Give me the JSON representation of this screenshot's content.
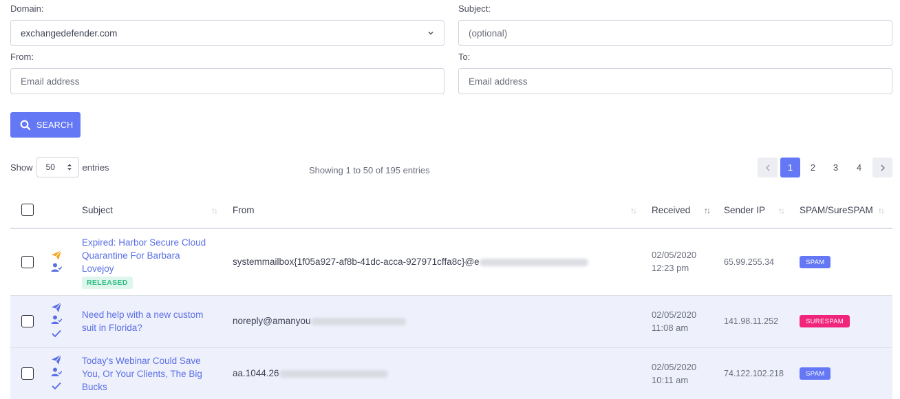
{
  "filters": {
    "domain_label": "Domain:",
    "domain_value": "exchangedefender.com",
    "subject_label": "Subject:",
    "subject_placeholder": "(optional)",
    "from_label": "From:",
    "from_placeholder": "Email address",
    "to_label": "To:",
    "to_placeholder": "Email address",
    "search_label": "SEARCH"
  },
  "table_controls": {
    "show_label": "Show",
    "page_length": "50",
    "entries_label": "entries",
    "info": "Showing 1 to 50 of 195 entries",
    "pages": [
      "1",
      "2",
      "3",
      "4"
    ],
    "current_page": "1"
  },
  "columns": [
    "Subject",
    "From",
    "Received",
    "Sender IP",
    "SPAM/SureSPAM"
  ],
  "rows": [
    {
      "subject_lines": [
        "Expired: Harbor Secure Cloud",
        "Quarantine For Barbara",
        "Lovejoy"
      ],
      "status": "RELEASED",
      "from": "systemmailbox{1f05a927-af8b-41dc-acca-927971cffa8c}@e",
      "received_date": "02/05/2020",
      "received_time": "12:23 pm",
      "sender_ip": "65.99.255.34",
      "classification": "SPAM"
    },
    {
      "subject_lines": [
        "Need help with a new custom",
        "suit in Florida?"
      ],
      "status": "",
      "from": "noreply@amanyou",
      "received_date": "02/05/2020",
      "received_time": "11:08 am",
      "sender_ip": "141.98.11.252",
      "classification": "SURESPAM"
    },
    {
      "subject_lines": [
        "Today's Webinar Could Save",
        "You, Or Your Clients, The Big",
        "Bucks"
      ],
      "status": "",
      "from": "aa.1044.26",
      "received_date": "02/05/2020",
      "received_time": "10:11 am",
      "sender_ip": "74.122.102.218",
      "classification": "SPAM"
    }
  ],
  "colors": {
    "accent": "#6478f5",
    "link": "#5a6fe6",
    "surespam": "#f0247a",
    "released_text": "#2ebd85",
    "row_highlight": "#eef0fc",
    "sent_icon_orange": "#f5a623"
  }
}
